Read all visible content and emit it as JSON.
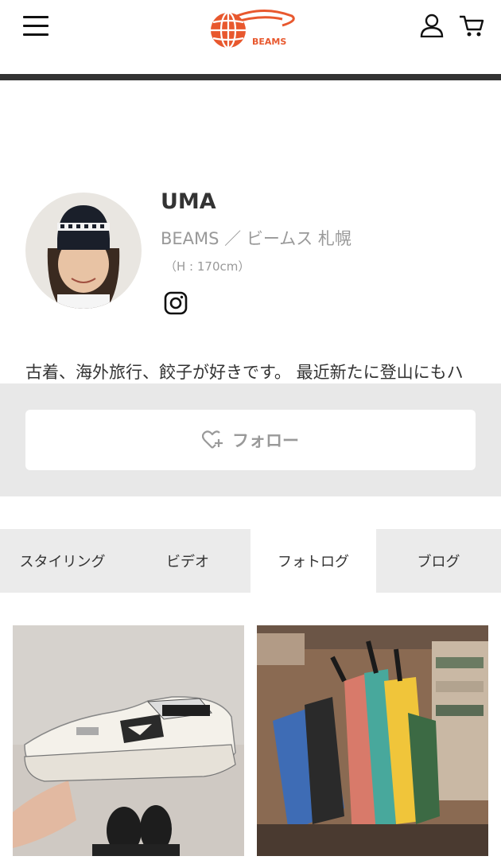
{
  "header": {
    "menu_icon": "hamburger-menu-icon",
    "logo_text": "BEAMS",
    "account_icon": "user-icon",
    "cart_icon": "cart-icon"
  },
  "profile": {
    "name": "UMA",
    "shop": "BEAMS ／ ビームス 札幌",
    "height": "（H : 170cm）",
    "social_icon": "instagram-icon",
    "bio": "古着、海外旅行、餃子が好きです。 最近新たに登山にもハマり始めました。"
  },
  "follow": {
    "label": "フォロー",
    "icon": "heart-plus-icon"
  },
  "tabs": [
    {
      "label": "スタイリング",
      "active": false
    },
    {
      "label": "ビデオ",
      "active": false
    },
    {
      "label": "フォトログ",
      "active": true
    },
    {
      "label": "ブログ",
      "active": false
    }
  ],
  "photos": [
    {
      "subject": "white sneaker held in hand"
    },
    {
      "subject": "colorful bags hanging on rack"
    }
  ],
  "colors": {
    "brand_orange": "#e8582e",
    "header_bar": "#333333",
    "follow_bg": "#e8e8e8",
    "tab_bg": "#ebebeb"
  }
}
